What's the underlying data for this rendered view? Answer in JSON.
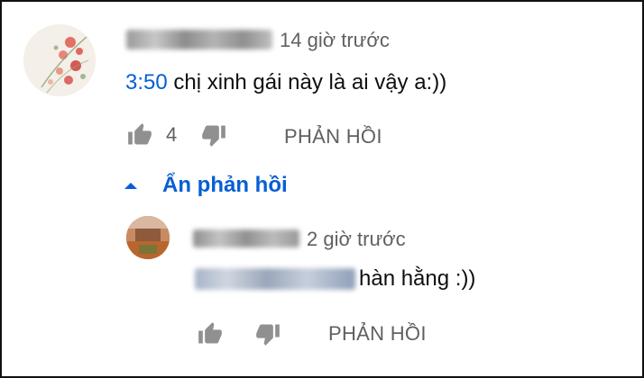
{
  "top_comment": {
    "time": "14 giờ trước",
    "timestamp_link": "3:50",
    "text": "chị xinh gái này là ai vậy a:))",
    "like_count": "4",
    "reply_label": "PHẢN HỒI"
  },
  "replies_toggle": {
    "label": "Ẩn phản hồi"
  },
  "reply": {
    "time": "2 giờ trước",
    "text": "hàn hằng :))",
    "reply_label": "PHẢN HỒI"
  },
  "colors": {
    "link": "#065fd4",
    "meta": "#606060",
    "text": "#0f0f0f",
    "icon": "#909090"
  }
}
